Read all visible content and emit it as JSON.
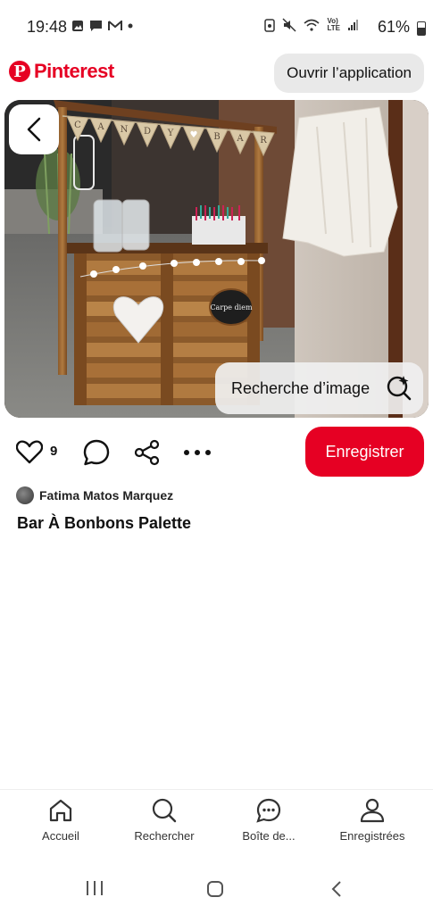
{
  "status_bar": {
    "time": "19:48",
    "network_label": "Vo)\nLTE",
    "battery": "61%"
  },
  "header": {
    "logo_text": "Pinterest",
    "open_app_label": "Ouvrir l’application"
  },
  "photo": {
    "image_search_label": "Recherche d’image",
    "bunting_letters": [
      "C",
      "A",
      "N",
      "D",
      "Y",
      "♥",
      "B",
      "A",
      "R"
    ],
    "chalkboard_text": "Carpe diem"
  },
  "actions": {
    "like_count": "9",
    "save_label": "Enregistrer"
  },
  "pin": {
    "author": "Fatima Matos Marquez",
    "title": "Bar À Bonbons Palette"
  },
  "bottom_nav": {
    "items": [
      {
        "label": "Accueil",
        "icon": "home-icon"
      },
      {
        "label": "Rechercher",
        "icon": "search-icon"
      },
      {
        "label": "Boîte de...",
        "icon": "chat-icon"
      },
      {
        "label": "Enregistrées",
        "icon": "profile-icon"
      }
    ]
  },
  "colors": {
    "brand": "#e60023"
  }
}
